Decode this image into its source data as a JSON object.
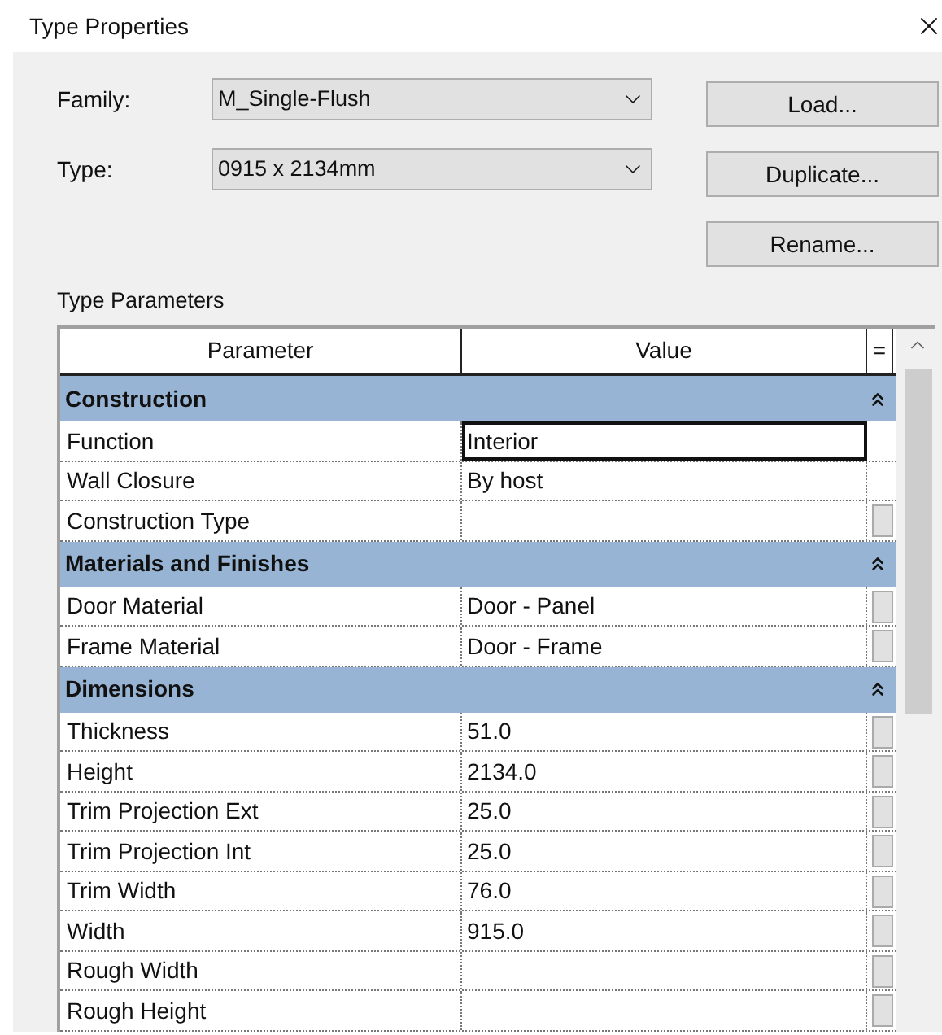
{
  "window": {
    "title": "Type Properties"
  },
  "fields": [
    {
      "label": "Family:",
      "value": "M_Single-Flush"
    },
    {
      "label": "Type:",
      "value": "0915 x 2134mm"
    }
  ],
  "buttons": [
    "Load...",
    "Duplicate...",
    "Rename..."
  ],
  "section_label": "Type Parameters",
  "table": {
    "columns": [
      "Parameter",
      "Value",
      "="
    ],
    "groups": [
      {
        "name": "Construction",
        "expanded": true,
        "rows": [
          {
            "parameter": "Function",
            "value": "Interior",
            "editing": true,
            "param_button": false
          },
          {
            "parameter": "Wall Closure",
            "value": "By host",
            "editing": false,
            "param_button": false
          },
          {
            "parameter": "Construction Type",
            "value": "",
            "editing": false,
            "param_button": true
          }
        ]
      },
      {
        "name": "Materials and Finishes",
        "expanded": true,
        "rows": [
          {
            "parameter": "Door Material",
            "value": "Door - Panel",
            "editing": false,
            "param_button": true
          },
          {
            "parameter": "Frame Material",
            "value": "Door - Frame",
            "editing": false,
            "param_button": true
          }
        ]
      },
      {
        "name": "Dimensions",
        "expanded": true,
        "rows": [
          {
            "parameter": "Thickness",
            "value": "51.0",
            "editing": false,
            "param_button": true
          },
          {
            "parameter": "Height",
            "value": "2134.0",
            "editing": false,
            "param_button": true
          },
          {
            "parameter": "Trim Projection Ext",
            "value": "25.0",
            "editing": false,
            "param_button": true
          },
          {
            "parameter": "Trim Projection Int",
            "value": "25.0",
            "editing": false,
            "param_button": true
          },
          {
            "parameter": "Trim Width",
            "value": "76.0",
            "editing": false,
            "param_button": true
          },
          {
            "parameter": "Width",
            "value": "915.0",
            "editing": false,
            "param_button": true
          },
          {
            "parameter": "Rough Width",
            "value": "",
            "editing": false,
            "param_button": true
          },
          {
            "parameter": "Rough Height",
            "value": "",
            "editing": false,
            "param_button": true
          }
        ]
      }
    ]
  }
}
